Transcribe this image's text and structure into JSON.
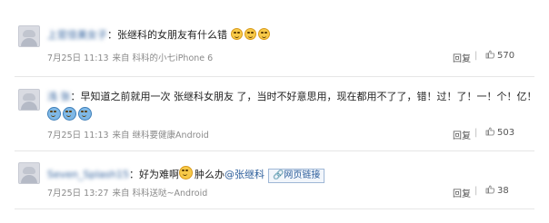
{
  "comments": [
    {
      "user": "上官佳美女子",
      "separator": "：",
      "text": "张继科的女朋友有什么错",
      "date": "7月25日 11:13",
      "source": "来自 科科的小七iPhone 6",
      "reply_label": "回复",
      "likes": "570"
    },
    {
      "user": "浅 张",
      "separator": "：",
      "text": "早知道之前就用一次 张继科女朋友 了，当时不好意思用，现在都用不了了，错！过！了！一！个！亿！",
      "date": "7月25日 11:13",
      "source": "来自 继科要健康Android",
      "reply_label": "回复",
      "likes": "503"
    },
    {
      "user": "Seven_Splash15",
      "separator": "：",
      "text_before": "好为难啊",
      "text_after": "肿么办",
      "mention": "@张继科",
      "link_label": "网页链接",
      "date": "7月25日 13:27",
      "source": "来自 科科送哒~Android",
      "reply_label": "回复",
      "likes": "38"
    }
  ],
  "icons": {
    "emoji_face": "smiley-face-icon",
    "emoji_tears": "laugh-cry-icon",
    "like": "thumbs-up-icon",
    "link": "link-icon"
  }
}
